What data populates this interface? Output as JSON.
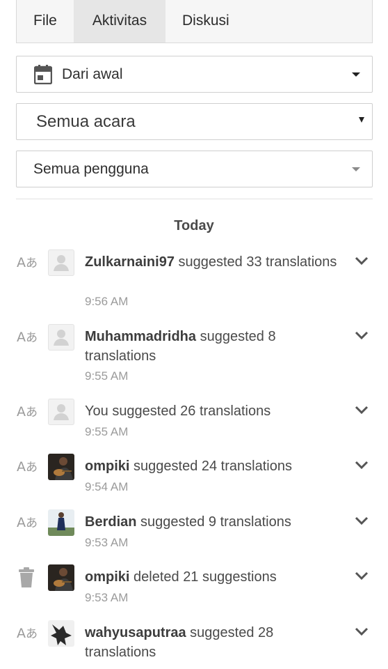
{
  "tabs": [
    {
      "label": "File"
    },
    {
      "label": "Aktivitas"
    },
    {
      "label": "Diskusi"
    }
  ],
  "filters": {
    "date": {
      "value": "Dari awal",
      "icon": "calendar-icon"
    },
    "events": {
      "value": "Semua acara"
    },
    "users": {
      "value": "Semua pengguna"
    }
  },
  "section_heading": "Today",
  "activities": [
    {
      "user": "Zulkarnaini97",
      "action": "suggested 33 translations",
      "time": "9:56 AM",
      "icon": "translate-icon",
      "avatar": "placeholder"
    },
    {
      "user": "Muhammadridha",
      "action": "suggested 8 translations",
      "time": "9:55 AM",
      "icon": "translate-icon",
      "avatar": "placeholder"
    },
    {
      "user": "You",
      "action": "suggested 26 translations",
      "time": "9:55 AM",
      "icon": "translate-icon",
      "avatar": "placeholder"
    },
    {
      "user": "ompiki",
      "action": "suggested 24 translations",
      "time": "9:54 AM",
      "icon": "translate-icon",
      "avatar": "photo-guitar"
    },
    {
      "user": "Berdian",
      "action": "suggested 9 translations",
      "time": "9:53 AM",
      "icon": "translate-icon",
      "avatar": "photo-outdoor"
    },
    {
      "user": "ompiki",
      "action": "deleted 21 suggestions",
      "time": "9:53 AM",
      "icon": "trash-icon",
      "avatar": "photo-guitar"
    },
    {
      "user": "wahyusaputraa",
      "action": "suggested 28 translations",
      "time": "",
      "icon": "translate-icon",
      "avatar": "photo-bw"
    }
  ]
}
